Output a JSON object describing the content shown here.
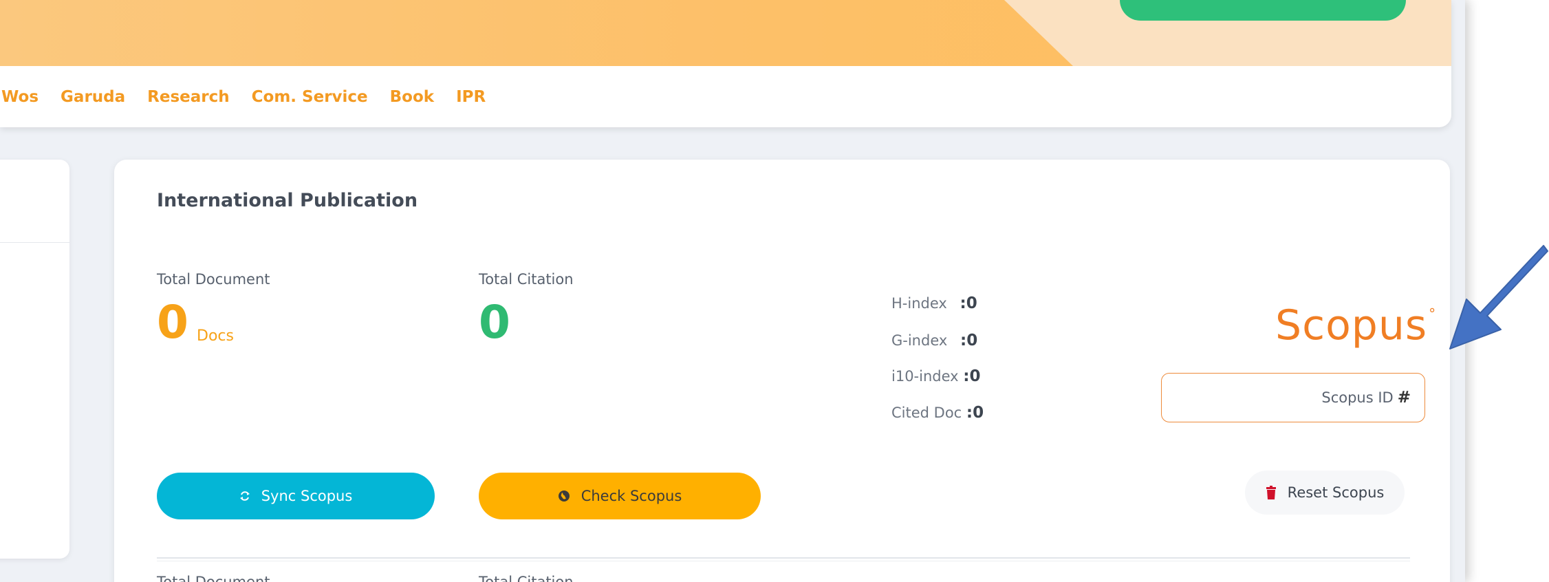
{
  "nav": {
    "items": [
      "Wos",
      "Garuda",
      "Research",
      "Com. Service",
      "Book",
      "IPR"
    ]
  },
  "card": {
    "title": "International Publication",
    "total_document_label": "Total Document",
    "total_document_value": "0",
    "total_document_unit": "Docs",
    "total_citation_label": "Total Citation",
    "total_citation_value": "0",
    "indices": [
      {
        "label": "H-index",
        "sep": ":",
        "value": "0"
      },
      {
        "label": "G-index",
        "sep": ":",
        "value": "0"
      },
      {
        "label": "i10-index",
        "sep": ":",
        "value": "0"
      },
      {
        "label": "Cited Doc",
        "sep": ":",
        "value": "0"
      }
    ],
    "logo_text": "Scopus",
    "logo_mark": "°",
    "scopus_id_label": "Scopus ID",
    "scopus_id_hash": "#",
    "sync_label": "Sync Scopus",
    "check_label": "Check Scopus",
    "reset_label": "Reset Scopus",
    "peek_document_label": "Total Document",
    "peek_citation_label": "Total Citation"
  },
  "colors": {
    "banner": "#fdc069",
    "nav_text": "#f39a22",
    "sync_button": "#04b6d6",
    "check_button": "#ffb000",
    "reset_icon": "#d0112b",
    "scopus_logo": "#f07e24",
    "arrow": "#4472c4",
    "green_button": "#2ec07a"
  },
  "icons": {
    "sync": "sync-icon",
    "check": "globe-icon",
    "reset": "trash-icon",
    "annotation": "arrow-annotation-icon"
  }
}
